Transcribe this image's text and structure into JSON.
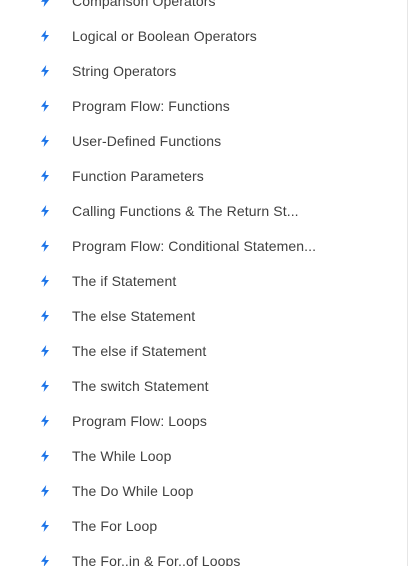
{
  "accent_color": "#1a73e8",
  "icon": "lightning-bolt-icon",
  "lessons": [
    {
      "label": "Comparison Operators"
    },
    {
      "label": "Logical or Boolean Operators"
    },
    {
      "label": "String Operators"
    },
    {
      "label": "Program Flow: Functions"
    },
    {
      "label": "User-Defined Functions"
    },
    {
      "label": "Function Parameters"
    },
    {
      "label": "Calling Functions & The Return St..."
    },
    {
      "label": "Program Flow: Conditional Statemen..."
    },
    {
      "label": "The if Statement"
    },
    {
      "label": "The else Statement"
    },
    {
      "label": "The else if Statement"
    },
    {
      "label": "The switch Statement"
    },
    {
      "label": "Program Flow: Loops"
    },
    {
      "label": "The While Loop"
    },
    {
      "label": "The Do While Loop"
    },
    {
      "label": "The For Loop"
    },
    {
      "label": "The For..in & For..of Loops"
    }
  ]
}
